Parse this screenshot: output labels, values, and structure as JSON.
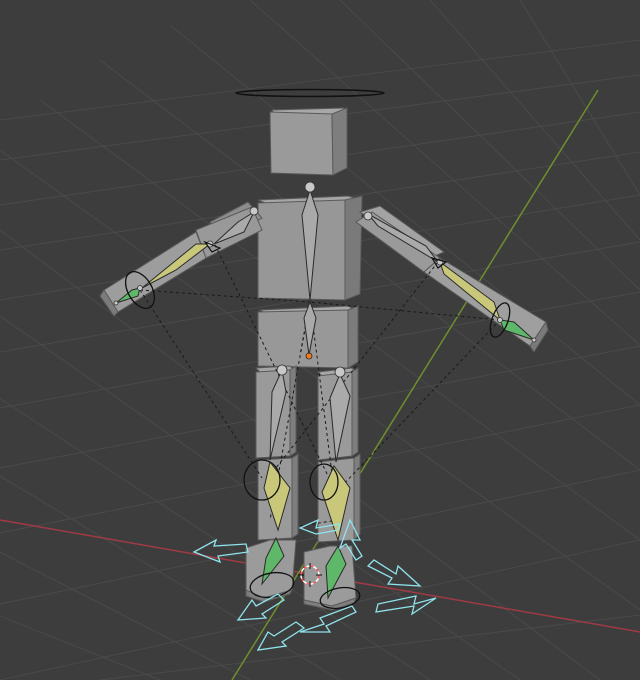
{
  "viewport": {
    "view": "3d-viewport",
    "mode": "pose",
    "colors": {
      "background": "#3d3d3d",
      "grid_line": "#4a4a4a",
      "x_axis": "#a03a45",
      "y_axis": "#6e8f2e",
      "mesh_light": "#9d9d9d",
      "mesh_mid": "#8a8a8a",
      "mesh_dark": "#727272",
      "bone": "#aaaaaa",
      "bone_ik": "#c9c77a",
      "bone_selected": "#5fb86a",
      "gizmo": "#8fe3ec",
      "cursor_3d": "#ff5555",
      "origin": "#f07a1e"
    },
    "icons": [
      "root-control-circle-icon",
      "pole-target-icon",
      "move-arrows-gizmo-icon",
      "3d-cursor-icon",
      "object-origin-icon"
    ]
  }
}
